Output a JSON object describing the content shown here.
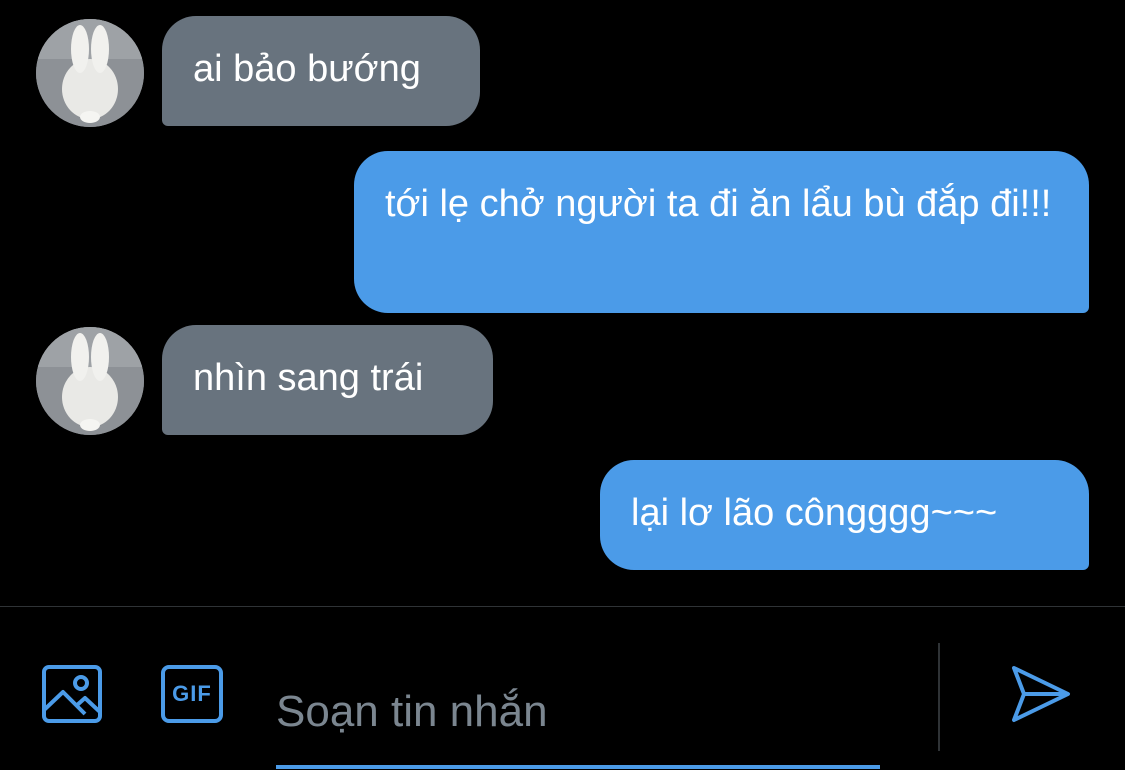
{
  "messages": [
    {
      "direction": "incoming",
      "text": "ai bảo bướng"
    },
    {
      "direction": "outgoing",
      "text": "tới lẹ chở người ta đi ăn lẩu bù đắp đi!!!"
    },
    {
      "direction": "incoming",
      "text": "nhìn sang trái"
    },
    {
      "direction": "outgoing",
      "text": "lại lơ lão côngggg~~~"
    }
  ],
  "composer": {
    "placeholder": "Soạn tin nhắn",
    "gif_label": "GIF",
    "icons": {
      "media": "image-icon",
      "gif": "gif-icon",
      "send": "send-icon"
    }
  },
  "colors": {
    "background": "#000000",
    "incoming_bubble": "#68737e",
    "outgoing_bubble": "#4b9be8",
    "accent": "#4b9be8",
    "placeholder": "#7b8690"
  }
}
